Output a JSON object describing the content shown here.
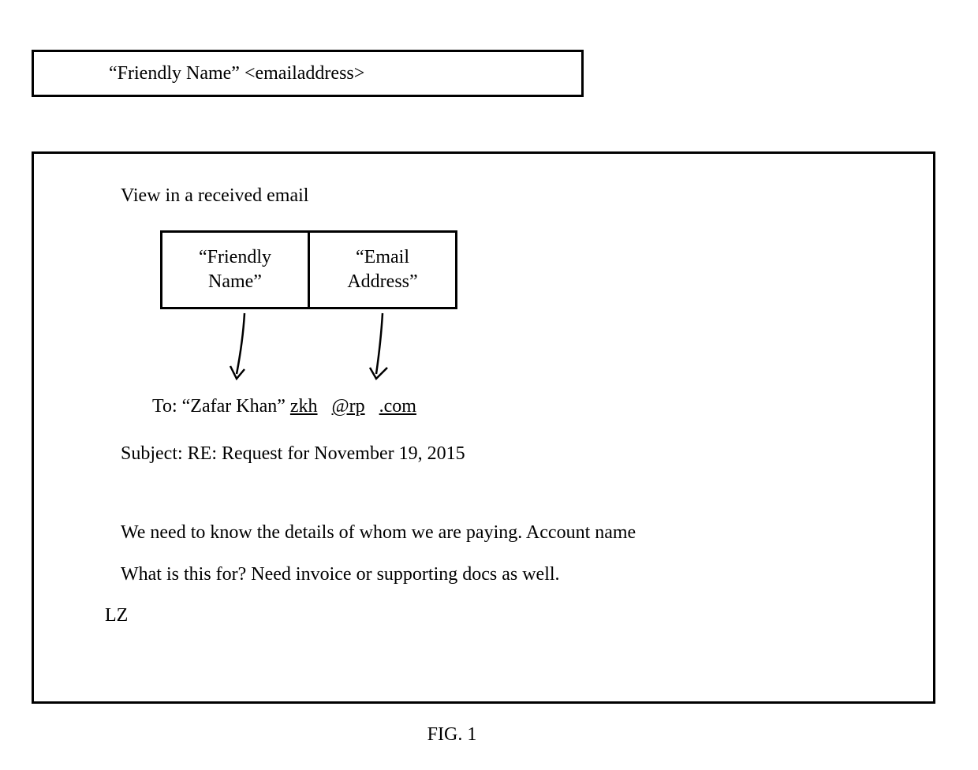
{
  "topBox": {
    "label": "“Friendly Name” <emailaddress>"
  },
  "mainBox": {
    "title": "View in a received email",
    "fields": {
      "friendlyName": "“Friendly\nName”",
      "emailAddress": "“Email\nAddress”"
    },
    "toLine": {
      "prefix": "To: “Zafar Khan” ",
      "emailPart1": "zkh",
      "emailAt": "@rp",
      "emailDot": ".com"
    },
    "subject": "Subject: RE: Request for November 19, 2015",
    "body": {
      "line1": "We need to know the details of whom we are paying. Account name",
      "line2": "What is this for?  Need invoice or supporting docs as well."
    },
    "signature": "LZ"
  },
  "figureLabel": "FIG. 1"
}
